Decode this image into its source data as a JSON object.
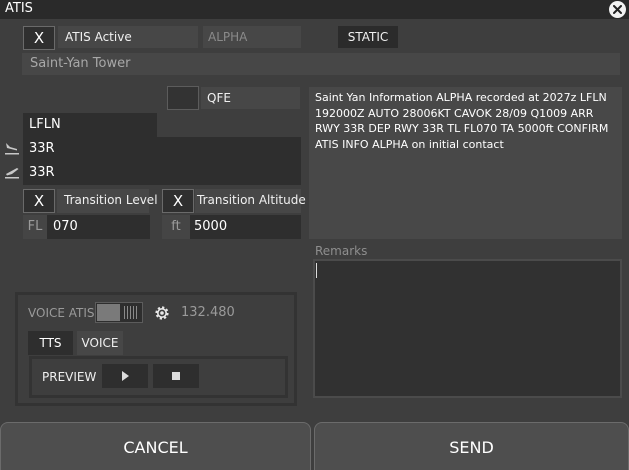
{
  "window": {
    "title": "ATIS"
  },
  "header": {
    "atis_active_check": "X",
    "atis_active_label": "ATIS Active",
    "letter": "ALPHA",
    "mode_button": "STATIC",
    "station_name": "Saint-Yan Tower"
  },
  "qfe": {
    "label": "QFE"
  },
  "fields": {
    "airport": "LFLN",
    "arrival_runway": "33R",
    "departure_runway": "33R"
  },
  "transition": {
    "level_check": "X",
    "level_label": "Transition Level",
    "level_prefix": "FL",
    "level_value": "070",
    "altitude_check": "X",
    "altitude_label": "Transition Altitude",
    "altitude_prefix": "ft",
    "altitude_value": "5000"
  },
  "atis_text": "Saint Yan Information ALPHA recorded at 2027z LFLN 192000Z AUTO 28006KT CAVOK 28/09 Q1009 ARR RWY 33R DEP RWY 33R TL FL070 TA 5000ft CONFIRM ATIS INFO ALPHA on initial contact",
  "remarks": {
    "label": "Remarks",
    "value": ""
  },
  "voice": {
    "label": "VOICE ATIS",
    "frequency": "132.480",
    "tab_tts": "TTS",
    "tab_voice": "VOICE",
    "preview_label": "PREVIEW"
  },
  "footer": {
    "cancel": "CANCEL",
    "send": "SEND"
  },
  "icons": {
    "arrival": "plane-landing-icon",
    "departure": "plane-takeoff-icon",
    "settings": "gear-icon",
    "play": "play-icon",
    "stop": "stop-icon",
    "close": "close-icon"
  }
}
